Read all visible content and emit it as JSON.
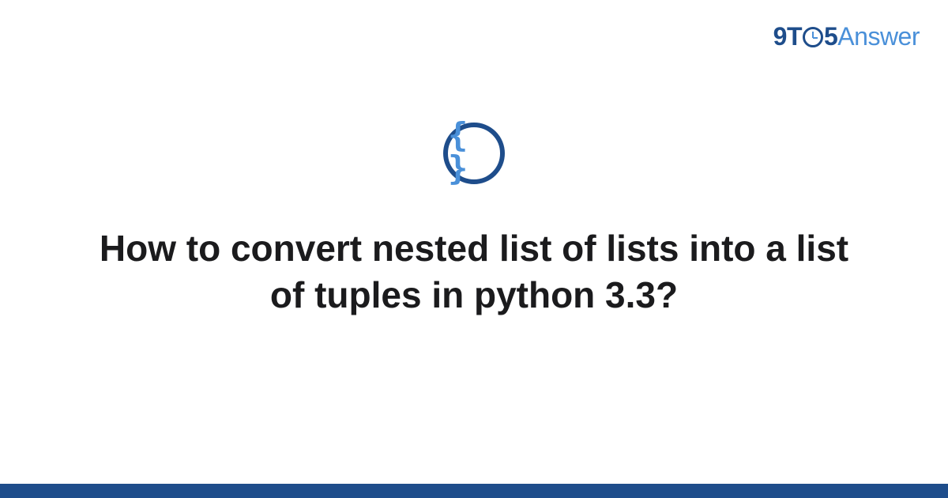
{
  "logo": {
    "part1": "9T",
    "part2": "5",
    "part3": "Answer"
  },
  "icon": {
    "braces": "{ }"
  },
  "title": "How to convert nested list of lists into a list of tuples in python 3.3?"
}
